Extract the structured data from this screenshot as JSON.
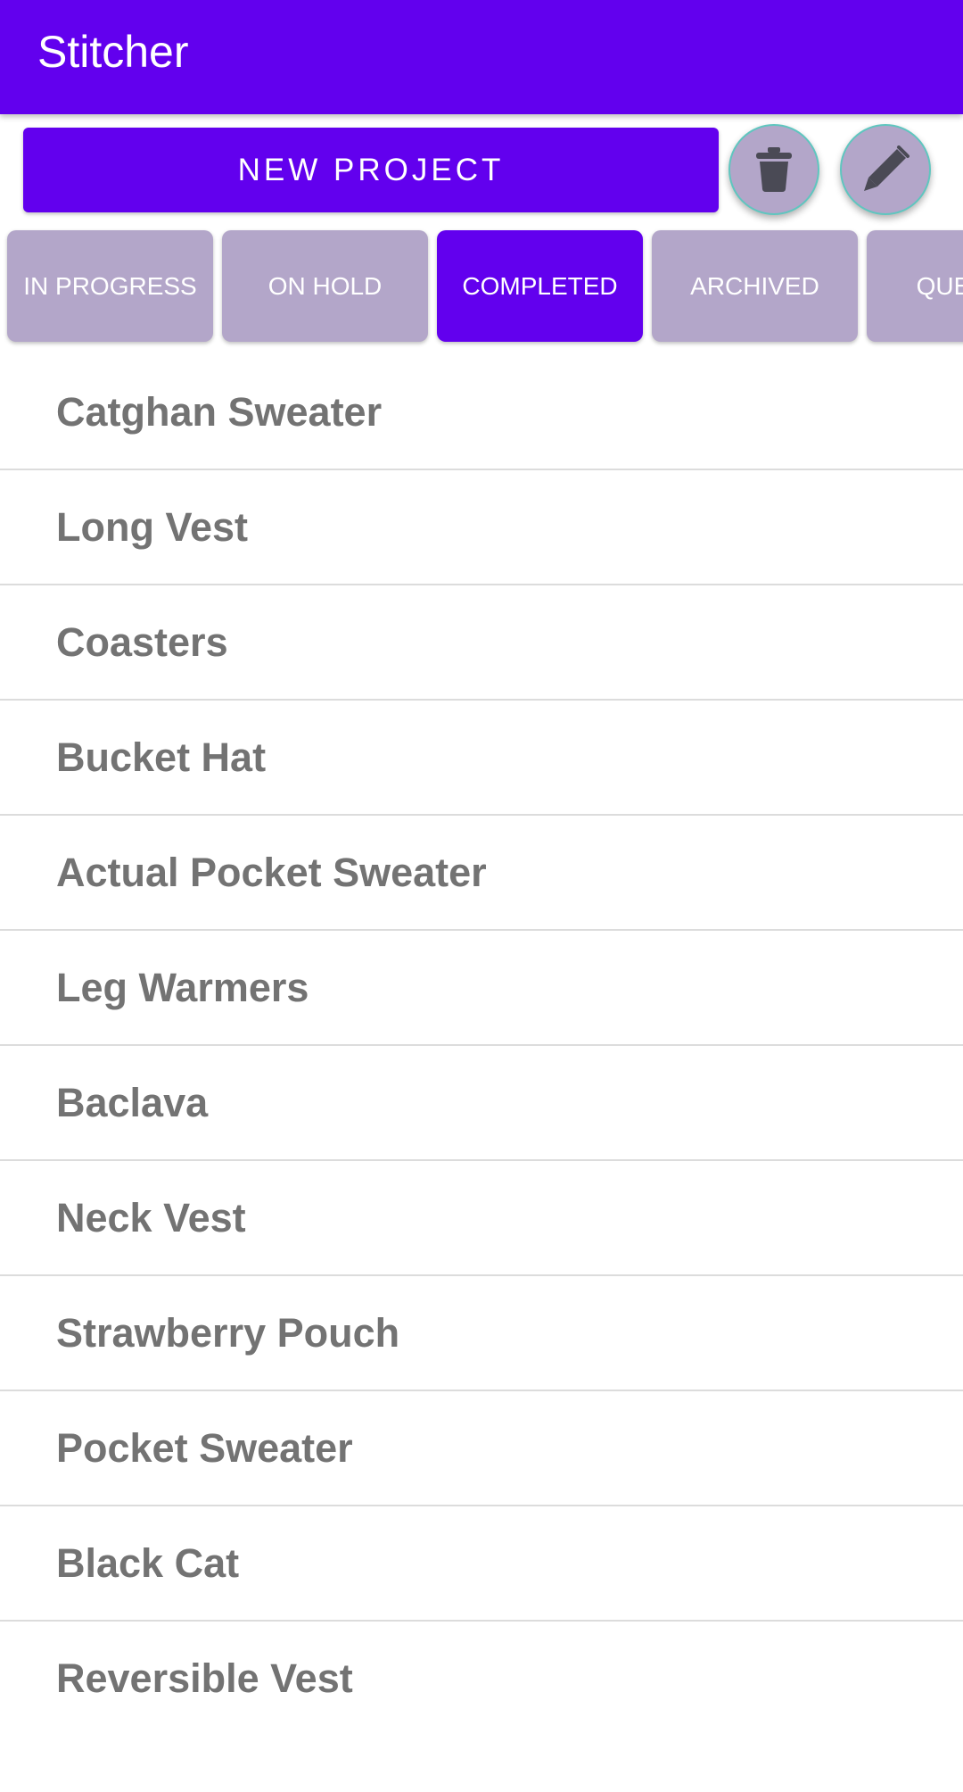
{
  "app": {
    "title": "Stitcher"
  },
  "toolbar": {
    "new_project_label": "NEW PROJECT",
    "delete_icon": "trash-icon",
    "edit_icon": "pencil-icon"
  },
  "tabs": [
    {
      "label": "IN PROGRESS",
      "active": false
    },
    {
      "label": "ON HOLD",
      "active": false
    },
    {
      "label": "COMPLETED",
      "active": true
    },
    {
      "label": "ARCHIVED",
      "active": false
    },
    {
      "label": "QUEUED",
      "active": false
    }
  ],
  "projects": [
    "Catghan Sweater",
    "Long Vest",
    "Coasters",
    "Bucket Hat",
    "Actual Pocket Sweater",
    "Leg Warmers",
    "Baclava",
    "Neck Vest",
    "Strawberry Pouch",
    "Pocket Sweater",
    "Black Cat",
    "Reversible Vest"
  ],
  "colors": {
    "primary": "#6200ee",
    "tab_inactive": "#b3a6c9",
    "list_text": "#737373",
    "fab_border": "#5fc6bf"
  }
}
